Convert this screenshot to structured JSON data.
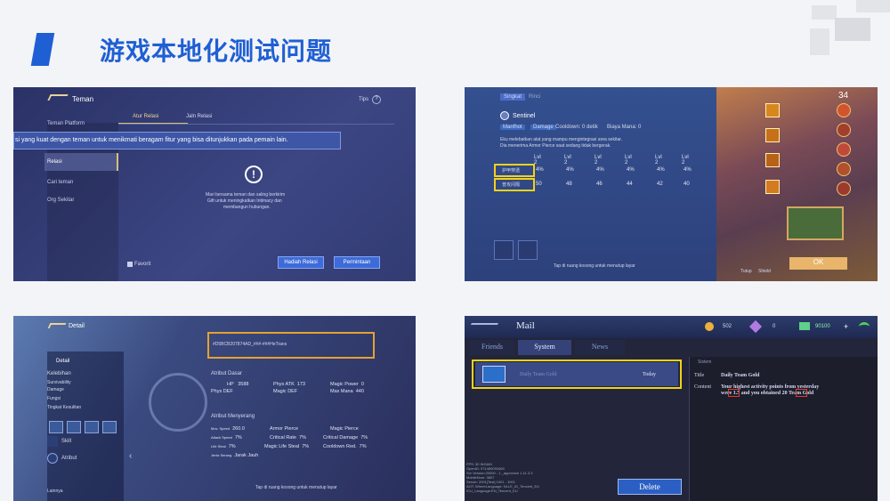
{
  "slide": {
    "title": "游戏本地化测试问题"
  },
  "shot1": {
    "header_title": "Teman",
    "tips": "Tips",
    "side_items": [
      "Teman Platform",
      "Relasi",
      "Cari teman",
      "Org Sekitar"
    ],
    "tab_active": "Atur Relasi",
    "tab_other": "Jaln Relasi",
    "banner_text": "si yang kuat dengan teman untuk menikmati beragam fitur yang bisa ditunjukkan pada pemain lain.",
    "center_lines": [
      "Mari bersama teman dan saling berkirim",
      "Gift untuk meningkatkan Intimacy dan",
      "membangun hubungan."
    ],
    "favorit": "Favorit",
    "btn_gift": "Hadiah Relasi",
    "btn_request": "Permintaan"
  },
  "shot2": {
    "tab_active": "Singkat",
    "tab_other": "Rinci",
    "skill_name": "Sentinel",
    "tags": [
      "Manfhot",
      "Damage"
    ],
    "cooldown": "Cooldown: 0 detik",
    "mana": "Biaya Mana: 0",
    "desc_lines": [
      "Eku melebatkan alat yang mampu mengintegrasi area sekitar.",
      "Dia menerima Armor Pierce saat sedang tidak bergerak."
    ],
    "level_header": [
      "Lvl 2",
      "Lvl 2",
      "Lvl 2",
      "Lvl 2",
      "Lvl 2",
      "Lvl 2"
    ],
    "row1_label": "护甲穿透",
    "row1_values": [
      "4%",
      "4%",
      "4%",
      "4%",
      "4%",
      "4%"
    ],
    "row2_label": "普攻间隔",
    "row2_values": [
      "50",
      "48",
      "46",
      "44",
      "42",
      "40"
    ],
    "hint": "Tap di ruang kosong untuk menutup layar",
    "timer": "34",
    "ok_label": "OK",
    "bottom_labels": [
      "Tutup",
      "Shield"
    ]
  },
  "shot3": {
    "header_title": "Detail",
    "detail_tab": "Detail",
    "left_items": [
      "Kelebihan",
      "Survivability",
      "Damage",
      "Fungsi",
      "Tingkat Kesulitan"
    ],
    "btn_skill": "Skill",
    "btn_atribut": "Atribut",
    "lainnya": "Lainnya",
    "id_text": "#D5BCB207874AD_###-###HeTrans",
    "sec_dasar": "Atribut Dasar",
    "dasar_rows": [
      [
        "HP",
        "3588",
        "Phys ATK",
        "173",
        "Magic Power",
        "0"
      ],
      [
        "Phys DEF",
        "",
        "Magic DEF",
        "",
        "Max Mana",
        "440"
      ]
    ],
    "sec_menyerang": "Atribut Menyerang",
    "menyerang_rows": [
      [
        "Mov. Speed",
        "260.0",
        "Armor Pierce",
        "",
        "Magic Pierce",
        ""
      ],
      [
        "Attack Speed",
        "7%",
        "Critical Rate",
        "7%",
        "Critical Damage",
        "7%"
      ],
      [
        "Life Steal",
        "7%",
        "Magic Life Steal",
        "7%",
        "Cooldown Red.",
        "7%"
      ],
      [
        "Jenis Serang",
        "Jarak Jauh",
        "",
        "",
        "",
        ""
      ]
    ],
    "hint": "Tap di ruang kosong untuk menutup layar"
  },
  "shot4": {
    "title": "Mail",
    "currencies": [
      "502",
      "0",
      "90100"
    ],
    "tabs": [
      "Friends",
      "System",
      "News"
    ],
    "mail_item_title": "Daily Team Gold",
    "mail_item_date": "Today",
    "detail_header": "Sistem",
    "title_label": "Title",
    "title_value": "Daily Team Gold",
    "content_label": "Content",
    "content_line1": "Your highest activity points from yesterday",
    "content_line2": "were 1.5 and you obtained 20 Team Gold",
    "debug_lines": [
      "FPS: 30 INGAM",
      "OpenID: 971489093469",
      "Svr Version:20000 - 1 _approvice 1.11.3.3",
      "MobileNum: 3807",
      "Server: 2001[Test] 1001 - 1001",
      "AOT: WhereLanguage: NLLE_ID_Tencent_EU",
      "ICU_Language:EN_Tencent_EU"
    ],
    "delete_label": "Delete"
  }
}
